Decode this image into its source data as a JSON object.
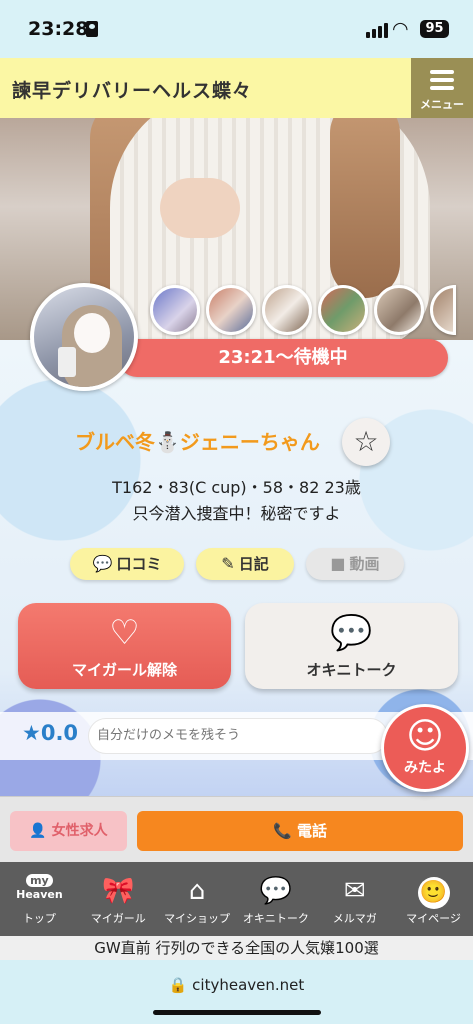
{
  "status_bar": {
    "time": "23:28",
    "battery": "95"
  },
  "header": {
    "shop_name": "諫早デリバリーヘルス蝶々",
    "menu_label": "メニュー"
  },
  "profile": {
    "status": "23:21～待機中",
    "name": "ブルベ冬⛄ジェニーちゃん",
    "stats": "T162・83(C cup)・58・82  23歳",
    "catchphrase": "只今潜入捜査中！秘密ですよ"
  },
  "chips": {
    "kuchikomi": "口コミ",
    "diary": "日記",
    "video": "動画"
  },
  "buttons": {
    "mygirl_remove": "マイガール解除",
    "okini_talk": "オキニトーク"
  },
  "memo": {
    "score": "0.0",
    "placeholder": "自分だけのメモを残そう"
  },
  "mitayo": {
    "label": "みたよ"
  },
  "action_bar": {
    "job": "女性求人",
    "phone": "電話"
  },
  "bottom_nav": {
    "items": [
      {
        "label": "トップ",
        "icon": "my-heaven-icon",
        "badge": "my\nHeaven"
      },
      {
        "label": "マイガール",
        "icon": "ribbon-icon"
      },
      {
        "label": "マイショップ",
        "icon": "shop-icon"
      },
      {
        "label": "オキニトーク",
        "icon": "chat-icon"
      },
      {
        "label": "メルマガ",
        "icon": "mail-icon"
      },
      {
        "label": "マイページ",
        "icon": "avatar-icon"
      }
    ]
  },
  "promo": "GW直前 行列のできる全国の人気嬢100選",
  "browser": {
    "url": "cityheaven.net"
  },
  "colors": {
    "accent": "#ef6b66",
    "header": "#fbf7a4",
    "name": "#f29a1c",
    "phone": "#f6871f"
  }
}
